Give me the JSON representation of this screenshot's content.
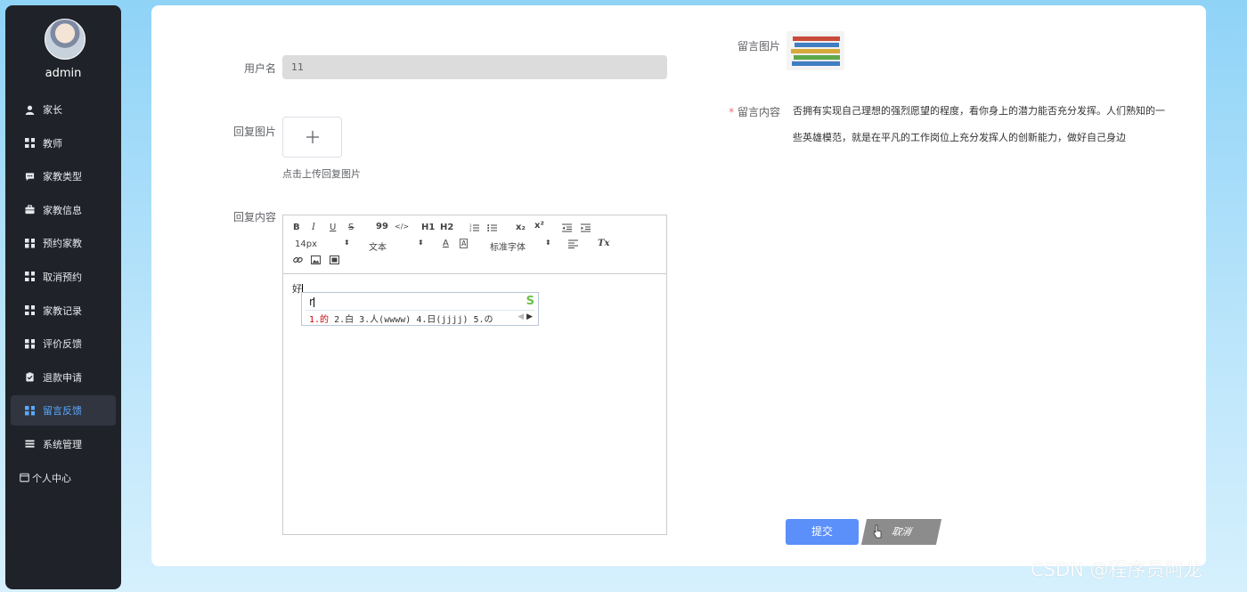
{
  "sidebar": {
    "username": "admin",
    "items": [
      {
        "label": "家长",
        "icon": "user-icon"
      },
      {
        "label": "教师",
        "icon": "grid-icon"
      },
      {
        "label": "家教类型",
        "icon": "chat-icon"
      },
      {
        "label": "家教信息",
        "icon": "briefcase-icon"
      },
      {
        "label": "预约家教",
        "icon": "grid-icon"
      },
      {
        "label": "取消预约",
        "icon": "grid-icon"
      },
      {
        "label": "家教记录",
        "icon": "grid-icon"
      },
      {
        "label": "评价反馈",
        "icon": "grid-icon"
      },
      {
        "label": "退款申请",
        "icon": "clipboard-icon"
      },
      {
        "label": "留言反馈",
        "icon": "grid-icon",
        "active": true
      },
      {
        "label": "系统管理",
        "icon": "list-icon"
      },
      {
        "label": "个人中心",
        "icon": "window-icon"
      }
    ]
  },
  "form": {
    "username_label": "用户名",
    "username_value": "11",
    "reply_image_label": "回复图片",
    "upload_hint": "点击上传回复图片",
    "reply_content_label": "回复内容",
    "message_image_label": "留言图片",
    "message_content_label": "留言内容",
    "required_mark": "*",
    "message_content": "否拥有实现自己理想的强烈愿望的程度，看你身上的潜力能否充分发挥。人们熟知的一些英雄模范，就是在平凡的工作岗位上充分发挥人的创新能力，做好自己身边"
  },
  "editor": {
    "toolbar": {
      "bold": "B",
      "italic": "I",
      "underline": "U",
      "strike": "S",
      "quote": "99",
      "code": "</>",
      "h1": "H1",
      "h2": "H2",
      "sub": "x₂",
      "sup": "x²",
      "font_size": "14px",
      "text_type": "文本",
      "font_family": "标准字体",
      "clear": "Tx"
    },
    "content": "好"
  },
  "ime": {
    "input": "r",
    "logo": "S",
    "candidates_first": "1.的",
    "candidates_rest": "2.白 3.人(wwww) 4.日(jjjj) 5.の"
  },
  "buttons": {
    "submit": "提交",
    "cancel": "取消"
  },
  "watermark": "CSDN @程序员阿龙",
  "colors": {
    "sidebar_bg": "#1f2329",
    "active_text": "#5aa9ff",
    "primary": "#5b8ff9",
    "required": "#f56c6c"
  }
}
